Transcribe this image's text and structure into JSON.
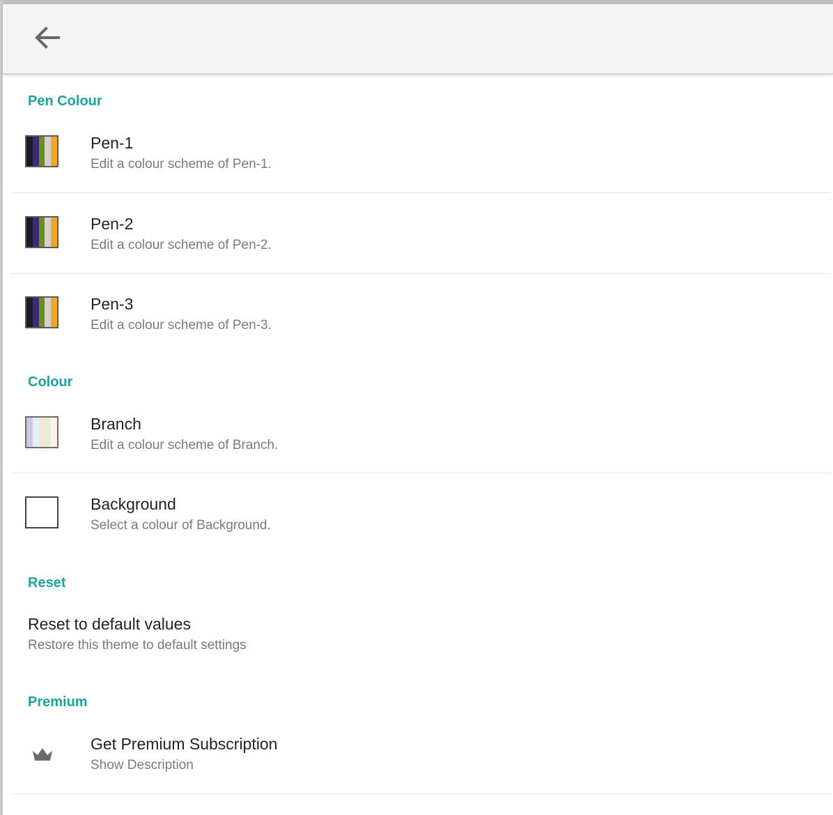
{
  "appbar": {
    "back_icon": "arrow-back-icon"
  },
  "sections": {
    "pen_colour": {
      "header": "Pen Colour",
      "items": [
        {
          "title": "Pen-1",
          "subtitle": "Edit a colour scheme of Pen-1.",
          "colors": [
            "#1a1a2e",
            "#3b2c73",
            "#6b8e23",
            "#d1d1d1",
            "#f5a623"
          ]
        },
        {
          "title": "Pen-2",
          "subtitle": "Edit a colour scheme of Pen-2.",
          "colors": [
            "#1a1a2e",
            "#3b2c73",
            "#6b8e23",
            "#d1d1d1",
            "#f5a623"
          ]
        },
        {
          "title": "Pen-3",
          "subtitle": "Edit a colour scheme of Pen-3.",
          "colors": [
            "#1a1a2e",
            "#3b2c73",
            "#6b8e23",
            "#d1d1d1",
            "#f5a623"
          ]
        }
      ]
    },
    "colour": {
      "header": "Colour",
      "branch": {
        "title": "Branch",
        "subtitle": "Edit a colour scheme of Branch.",
        "colors": [
          "#c9c9e6",
          "#e8eef5",
          "#f1e7d2",
          "#e3edd9",
          "#fdf3e6"
        ]
      },
      "background": {
        "title": "Background",
        "subtitle": "Select a colour of Background.",
        "color": "#ffffff"
      }
    },
    "reset": {
      "header": "Reset",
      "title": "Reset to default values",
      "subtitle": "Restore this theme to default settings"
    },
    "premium": {
      "header": "Premium",
      "title": "Get Premium Subscription",
      "subtitle": "Show Description",
      "icon": "crown-icon"
    }
  },
  "colors": {
    "accent": "#1aa39a",
    "subtitle": "#7a7a7a",
    "appbar": "#f4f4f4"
  }
}
